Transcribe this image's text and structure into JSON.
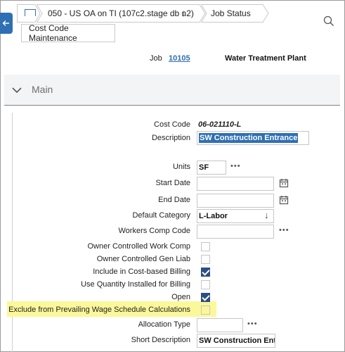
{
  "breadcrumb": {
    "job": "050 - US OA on TI (107c2.stage db n2)",
    "job_arrow": "↓",
    "status": "Job Status"
  },
  "tab": {
    "label": "Cost Code Maintenance"
  },
  "job": {
    "label": "Job",
    "number": "10105",
    "name": "Water Treatment Plant"
  },
  "section": {
    "title": "Main"
  },
  "form": {
    "cost_code_label": "Cost Code",
    "cost_code_value": "06-021110-L",
    "description_label": "Description",
    "description_value": "SW Construction Entrance",
    "units_label": "Units",
    "units_value": "SF",
    "start_date_label": "Start Date",
    "start_date_value": "",
    "end_date_label": "End Date",
    "end_date_value": "",
    "default_category_label": "Default Category",
    "default_category_value": "L-Labor",
    "default_category_arrow": "↓",
    "workers_comp_label": "Workers Comp Code",
    "workers_comp_value": "",
    "owner_work_comp_label": "Owner Controlled Work Comp",
    "owner_work_comp_checked": false,
    "owner_gen_liab_label": "Owner Controlled Gen Liab",
    "owner_gen_liab_checked": false,
    "include_billing_label": "Include in Cost-based Billing",
    "include_billing_checked": true,
    "use_qty_label": "Use Quantity Installed for Billing",
    "use_qty_checked": false,
    "open_label": "Open",
    "open_checked": true,
    "exclude_wage_label": "Exclude from Prevailing Wage Schedule Calculations",
    "exclude_wage_checked": false,
    "allocation_type_label": "Allocation Type",
    "allocation_type_value": "",
    "short_description_label": "Short Description",
    "short_description_value": "SW Construction Entra",
    "more_dots": "•••"
  },
  "colors": {
    "accent": "#2f6fb4",
    "checkbox_on": "#2c4e86",
    "highlight": "#fbf89b"
  },
  "icons": [
    "back-arrow-icon",
    "home-icon",
    "search-icon",
    "chevron-down-icon",
    "calendar-icon"
  ]
}
